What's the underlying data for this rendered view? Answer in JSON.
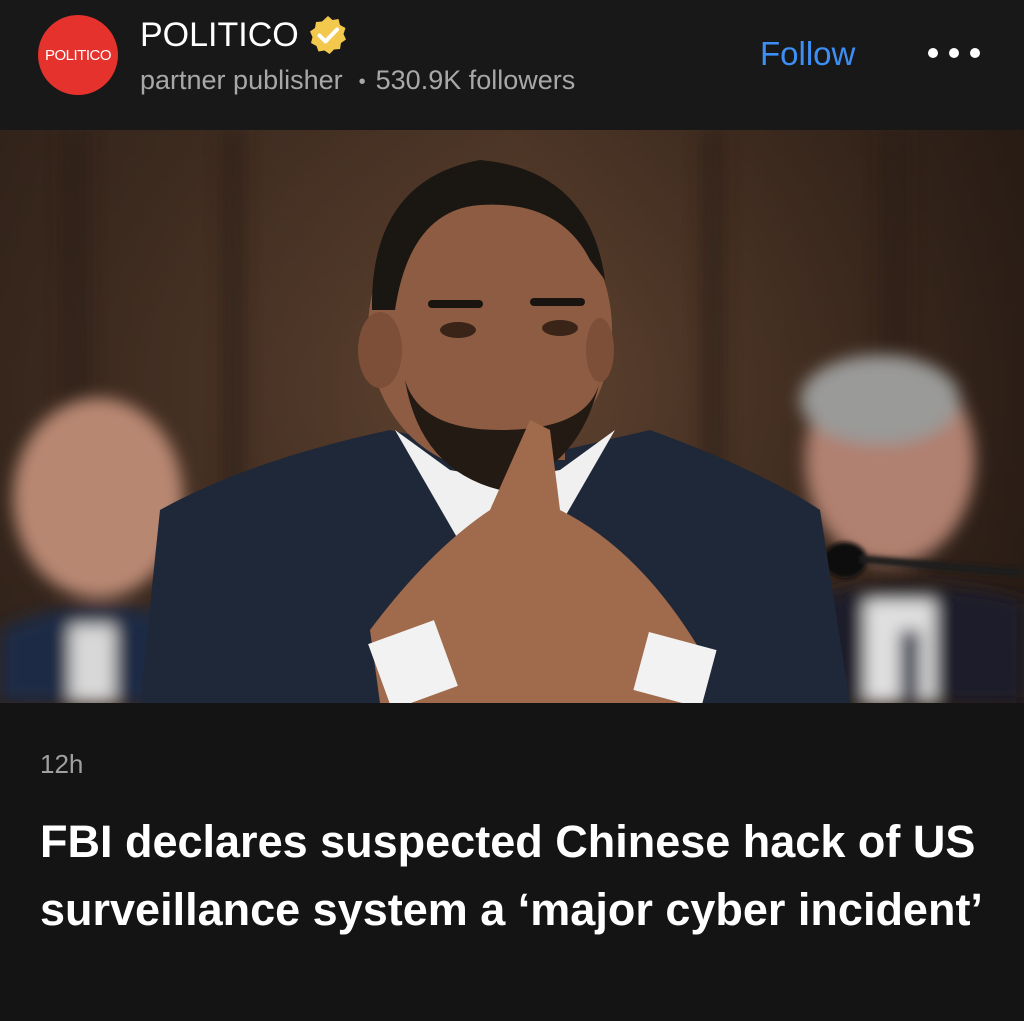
{
  "publisher": {
    "logo_text": "POLITICO",
    "name": "POLITICO",
    "verified_icon": "verified-badge-icon",
    "type": "partner publisher",
    "separator": "•",
    "followers": "530.9K followers",
    "follow_label": "Follow",
    "more_icon": "more-options-icon",
    "brand_color": "#e5322d",
    "follow_color": "#3d8ff5"
  },
  "article": {
    "image_description": "news-photo",
    "age": "12h",
    "headline": "FBI declares suspected Chinese hack of US surveillance system a ‘major cyber incident’"
  }
}
